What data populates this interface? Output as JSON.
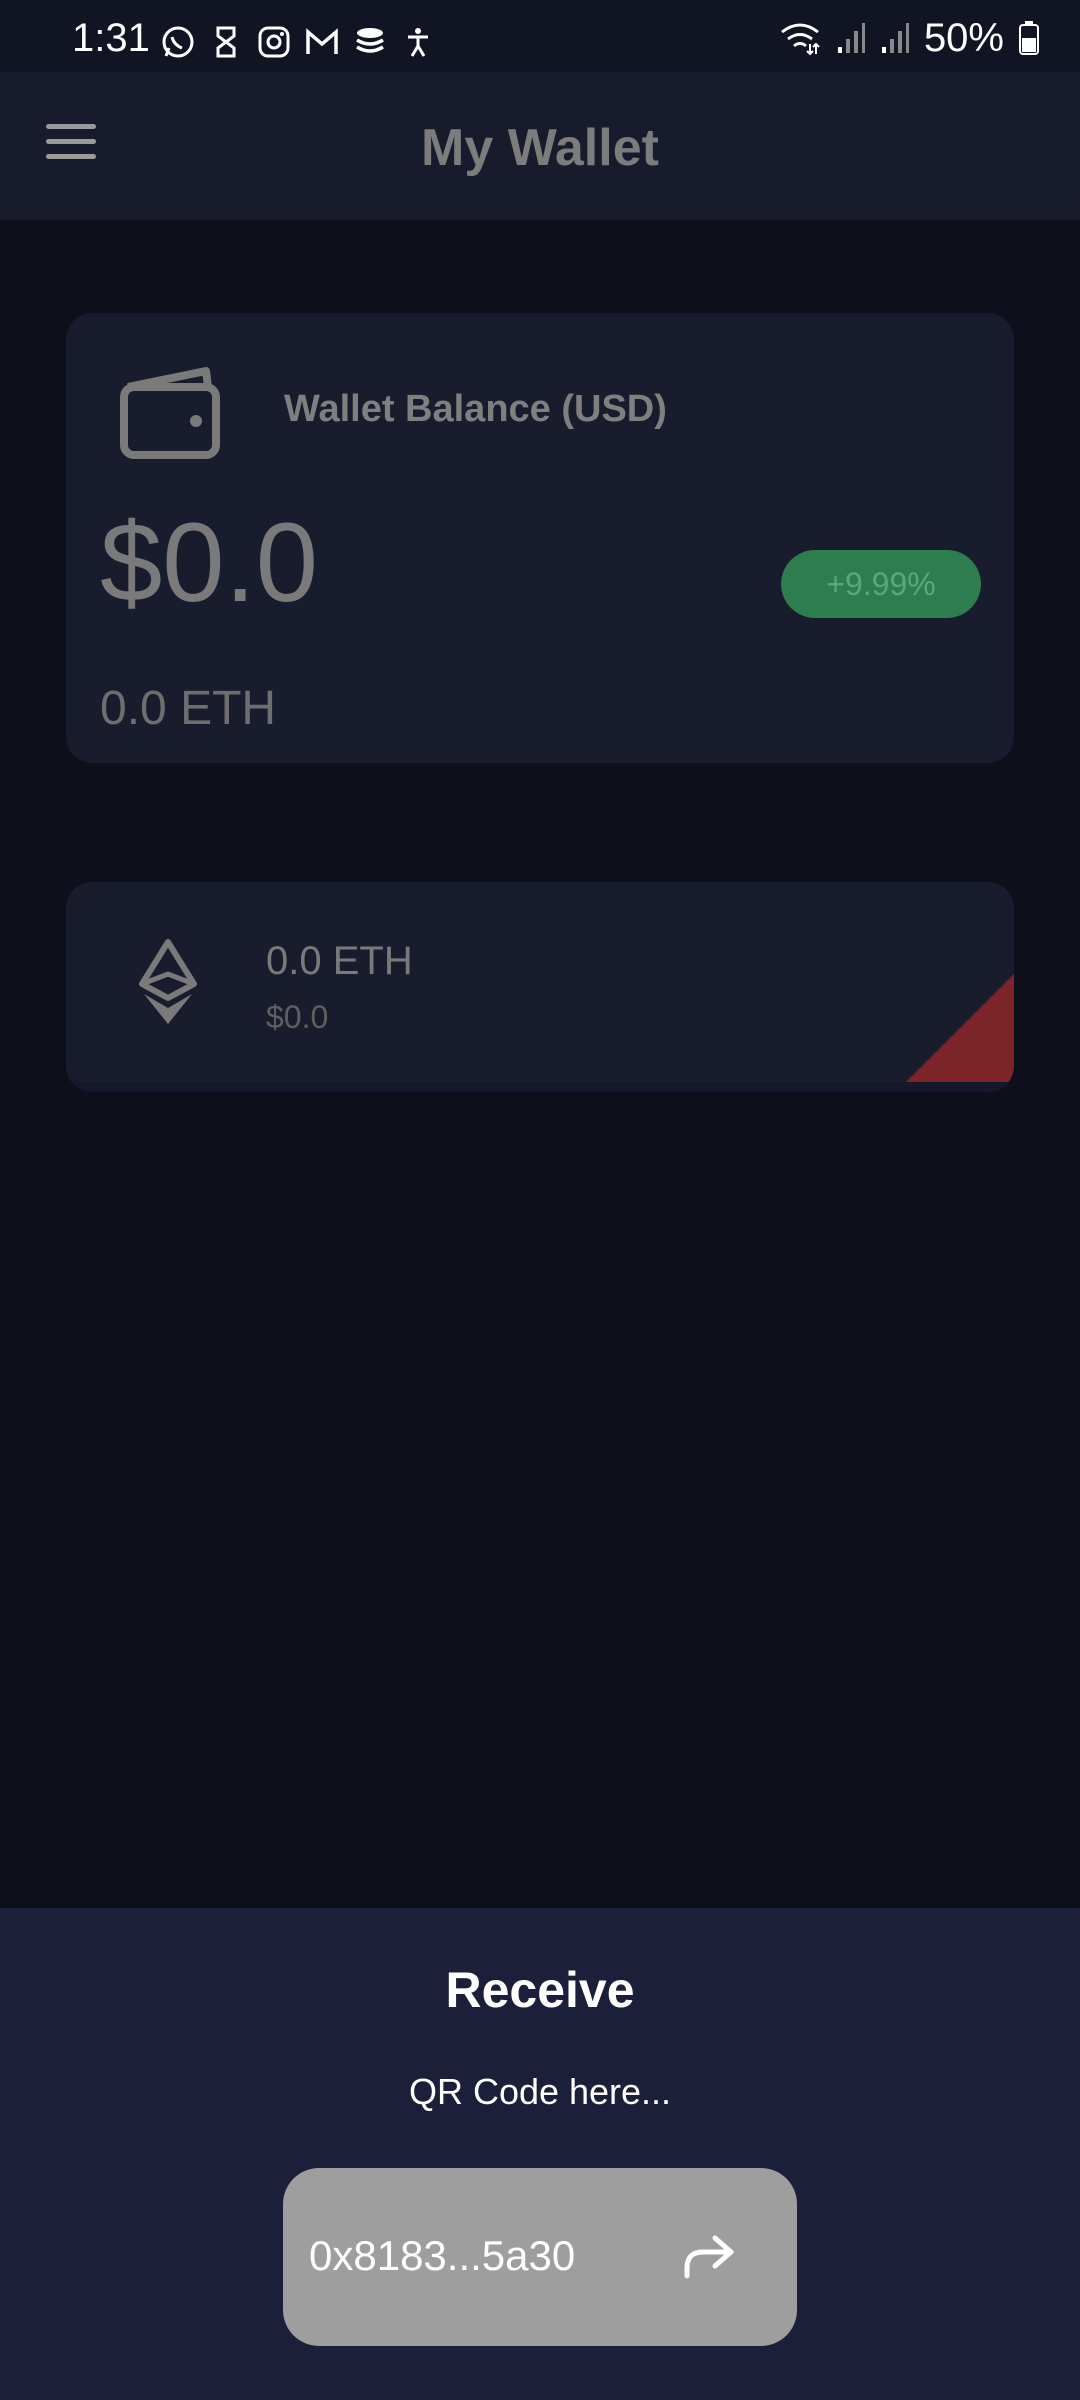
{
  "status_bar": {
    "time": "1:31",
    "battery_percent": "50%",
    "notification_icons": [
      "whatsapp-icon",
      "app-icon",
      "instagram-icon",
      "gmail-icon",
      "stack-icon",
      "accessibility-icon"
    ],
    "system_icons": [
      "wifi-icon",
      "signal-icon",
      "signal-icon",
      "battery-icon"
    ]
  },
  "app_bar": {
    "title": "My Wallet",
    "menu_icon": "menu-icon"
  },
  "balance_card": {
    "label": "Wallet Balance (USD)",
    "usd_value": "$0.0",
    "change_badge": "+9.99%",
    "eth_value": "0.0 ETH",
    "icon": "wallet-icon"
  },
  "asset": {
    "amount": "0.0 ETH",
    "usd_value": "$0.0",
    "icon": "ethereum-icon"
  },
  "receive_sheet": {
    "title": "Receive",
    "qr_placeholder": "QR Code here...",
    "address": "0x8183...5a30",
    "share_icon": "share-icon"
  },
  "colors": {
    "background": "#0d0f1a",
    "card": "#191c2d",
    "sheet": "#1b1f3a",
    "badge_green": "#2e7d4f",
    "corner_red": "#7c2528",
    "address_button": "#9e9e9e"
  }
}
